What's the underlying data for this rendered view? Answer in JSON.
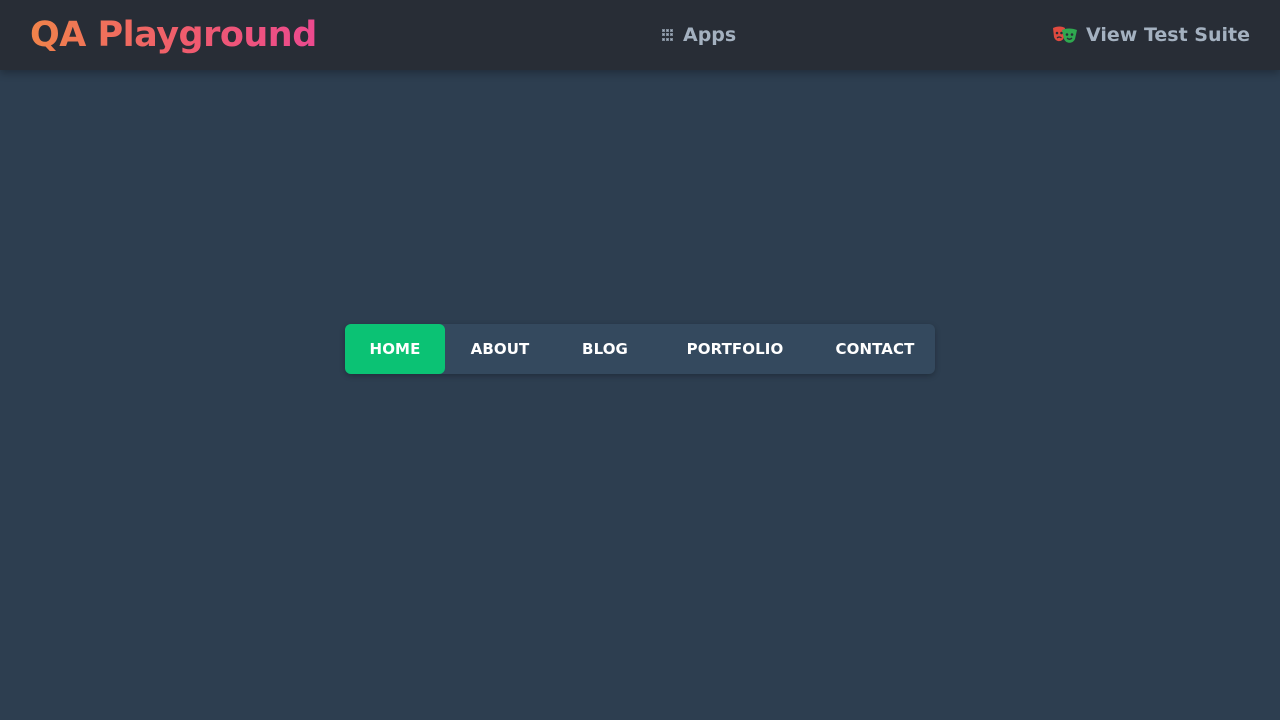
{
  "header": {
    "logo": "QA Playground",
    "apps_label": "Apps",
    "apps_icon": "grid-icon",
    "suite_label": "View Test Suite",
    "suite_icon": "theater-masks-icon"
  },
  "nav": {
    "items": [
      {
        "label": "HOME",
        "active": true
      },
      {
        "label": "ABOUT",
        "active": false
      },
      {
        "label": "BLOG",
        "active": false
      },
      {
        "label": "PORTFOLIO",
        "active": false
      },
      {
        "label": "CONTACT",
        "active": false
      }
    ]
  },
  "colors": {
    "page_background": "#2d3e50",
    "header_background": "#282d36",
    "nav_background": "#34495e",
    "active_item": "#0bc274",
    "logo_gradient_start": "#f0834a",
    "logo_gradient_end": "#ec4a8f",
    "header_link": "#a4b1c0"
  }
}
